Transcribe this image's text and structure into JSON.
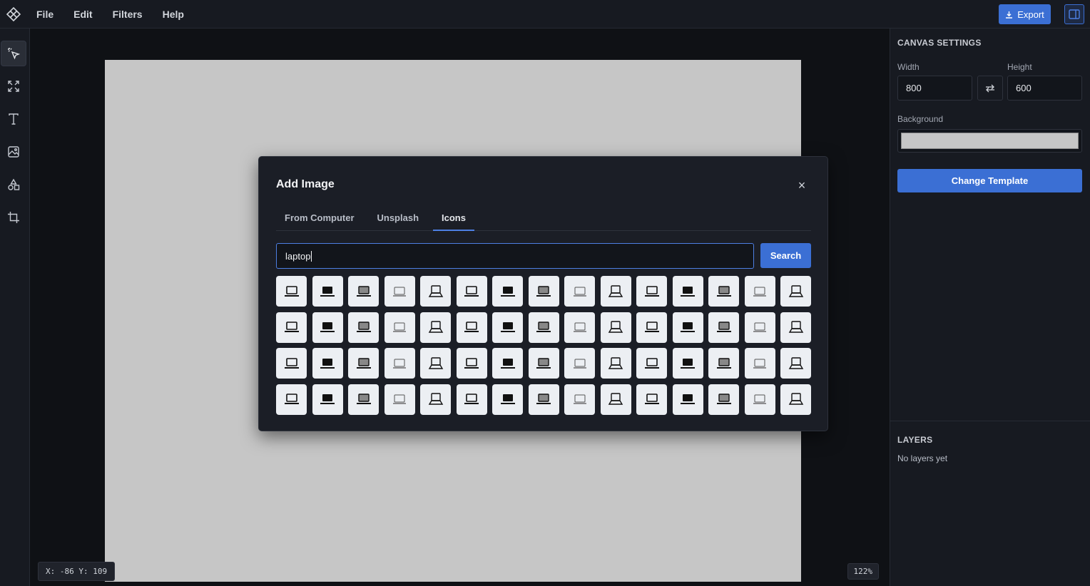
{
  "app": {
    "menu": [
      "File",
      "Edit",
      "Filters",
      "Help"
    ],
    "export_label": "Export"
  },
  "tools": [
    {
      "name": "select-tool",
      "icon": "cursor-icon",
      "active": true
    },
    {
      "name": "resize-tool",
      "icon": "expand-icon",
      "active": false
    },
    {
      "name": "text-tool",
      "icon": "text-icon",
      "active": false
    },
    {
      "name": "image-tool",
      "icon": "image-icon",
      "active": false
    },
    {
      "name": "shapes-tool",
      "icon": "shapes-icon",
      "active": false
    },
    {
      "name": "crop-tool",
      "icon": "crop-icon",
      "active": false
    }
  ],
  "canvas": {
    "background_color": "#c6c6c6",
    "coords": "X: -86 Y: 109",
    "zoom": "122%"
  },
  "panel": {
    "settings_title": "CANVAS SETTINGS",
    "width_label": "Width",
    "width_value": "800",
    "height_label": "Height",
    "height_value": "600",
    "background_label": "Background",
    "change_template_label": "Change Template",
    "layers_title": "LAYERS",
    "layers_empty": "No layers yet"
  },
  "modal": {
    "title": "Add Image",
    "close_symbol": "×",
    "tabs": [
      "From Computer",
      "Unsplash",
      "Icons"
    ],
    "active_tab": "Icons",
    "search_value": "laptop",
    "search_button": "Search",
    "result_icon": "laptop-icon",
    "result_count": 60
  },
  "colors": {
    "accent": "#3b6fd4",
    "accent_border": "#4d7fe3",
    "panel_bg": "#171a21",
    "modal_bg": "#1b1e26"
  }
}
